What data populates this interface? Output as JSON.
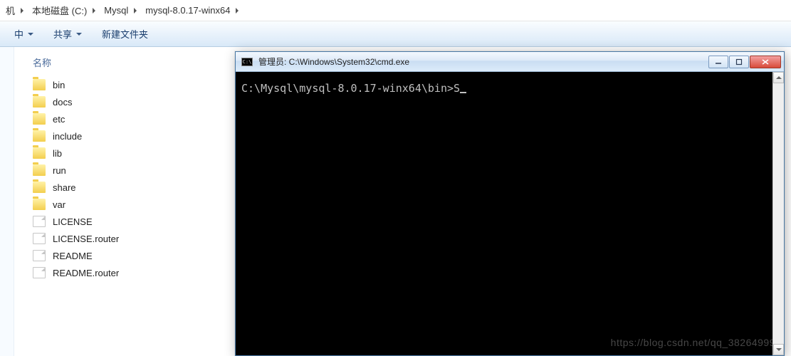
{
  "breadcrumbs": [
    {
      "label": "机"
    },
    {
      "label": "本地磁盘 (C:)"
    },
    {
      "label": "Mysql"
    },
    {
      "label": "mysql-8.0.17-winx64"
    }
  ],
  "toolbar": {
    "organize": "中",
    "share": "共享",
    "newfolder": "新建文件夹"
  },
  "columns": {
    "name": "名称"
  },
  "files": [
    {
      "name": "bin",
      "type": "folder"
    },
    {
      "name": "docs",
      "type": "folder"
    },
    {
      "name": "etc",
      "type": "folder"
    },
    {
      "name": "include",
      "type": "folder"
    },
    {
      "name": "lib",
      "type": "folder"
    },
    {
      "name": "run",
      "type": "folder"
    },
    {
      "name": "share",
      "type": "folder"
    },
    {
      "name": "var",
      "type": "folder"
    },
    {
      "name": "LICENSE",
      "type": "file"
    },
    {
      "name": "LICENSE.router",
      "type": "file"
    },
    {
      "name": "README",
      "type": "file"
    },
    {
      "name": "README.router",
      "type": "file"
    }
  ],
  "cmd": {
    "icon_text": "C:\\",
    "title": "管理员: C:\\Windows\\System32\\cmd.exe",
    "prompt": "C:\\Mysql\\mysql-8.0.17-winx64\\bin>",
    "input": "S"
  },
  "watermark": "https://blog.csdn.net/qq_38264999"
}
